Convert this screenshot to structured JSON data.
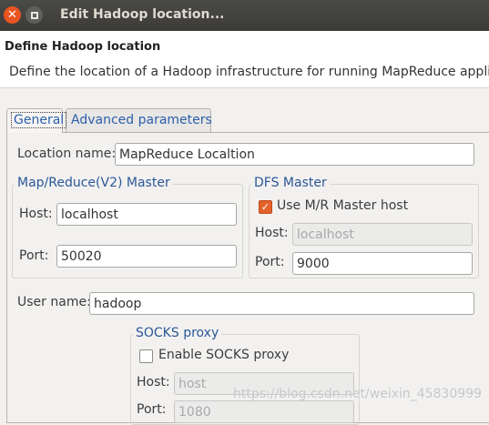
{
  "window": {
    "title": "Edit Hadoop location...",
    "close_glyph": "✕"
  },
  "header": {
    "title": "Define Hadoop location",
    "description": "Define the location of a Hadoop infrastructure for running MapReduce applicat"
  },
  "tabs": [
    {
      "label": "General",
      "active": true
    },
    {
      "label": "Advanced parameters",
      "active": false
    }
  ],
  "general": {
    "location_name_label": "Location name:",
    "location_name_value": "MapReduce Localtion",
    "mr_master": {
      "legend": "Map/Reduce(V2) Master",
      "host_label": "Host:",
      "host_value": "localhost",
      "port_label": "Port:",
      "port_value": "50020"
    },
    "dfs_master": {
      "legend": "DFS Master",
      "use_mr_label": "Use M/R Master host",
      "use_mr_checked": true,
      "host_label": "Host:",
      "host_value": "localhost",
      "port_label": "Port:",
      "port_value": "9000"
    },
    "user_name_label": "User name:",
    "user_name_value": "hadoop",
    "socks": {
      "legend": "SOCKS proxy",
      "enable_label": "Enable SOCKS proxy",
      "enable_checked": false,
      "host_label": "Host:",
      "host_value": "host",
      "port_label": "Port:",
      "port_value": "1080"
    }
  },
  "watermark": "https://blog.csdn.net/weixin_45830999",
  "colors": {
    "accent": "#e95420",
    "legend_text": "#2b5797",
    "titlebar": "#3c3b37"
  }
}
